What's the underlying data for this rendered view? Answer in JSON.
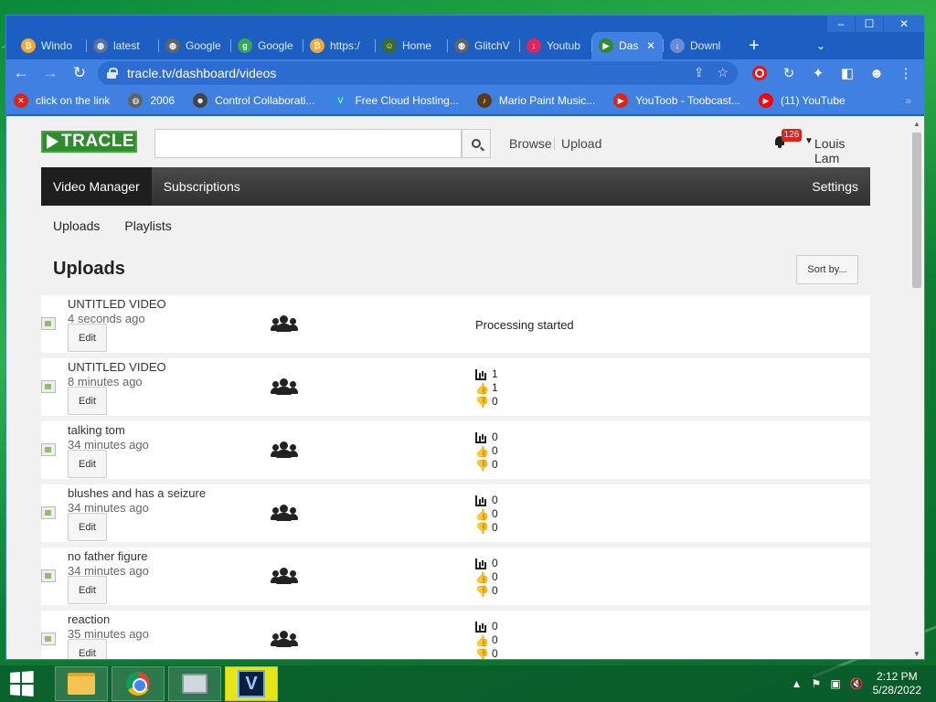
{
  "browser": {
    "tabs": [
      {
        "label": "Windo",
        "icon_color": "#f4a836",
        "icon_glyph": "₿",
        "active": false
      },
      {
        "label": "latest",
        "icon_color": "#5b6fa3",
        "icon_glyph": "◍",
        "active": false
      },
      {
        "label": "Google",
        "icon_color": "#5f6368",
        "icon_glyph": "◍",
        "active": false
      },
      {
        "label": "Google",
        "icon_color": "#34a853",
        "icon_glyph": "g",
        "active": false
      },
      {
        "label": "https:/",
        "icon_color": "#f4a836",
        "icon_glyph": "₿",
        "active": false
      },
      {
        "label": "Home",
        "icon_color": "#3d6b2a",
        "icon_glyph": "☺",
        "active": false
      },
      {
        "label": "GlitchV",
        "icon_color": "#5f6368",
        "icon_glyph": "◍",
        "active": false
      },
      {
        "label": "Youtub",
        "icon_color": "#e0245e",
        "icon_glyph": "↓",
        "active": false
      },
      {
        "label": "Das",
        "icon_color": "#2e8b2e",
        "icon_glyph": "▶",
        "active": true
      },
      {
        "label": "Downl",
        "icon_color": "#6b8bd6",
        "icon_glyph": "↓",
        "active": false
      }
    ],
    "new_tab_glyph": "+",
    "url": "tracle.tv/dashboard/videos",
    "bookmarks": [
      {
        "label": "click on the link",
        "icon_color": "#d9251c",
        "icon_glyph": "✕"
      },
      {
        "label": "2006",
        "icon_color": "#5f6368",
        "icon_glyph": "◍"
      },
      {
        "label": "Control Collaborati...",
        "icon_color": "#444444",
        "icon_glyph": "☻"
      },
      {
        "label": "Free Cloud Hosting...",
        "icon_color": "#2a8be0",
        "icon_glyph": "V"
      },
      {
        "label": "Mario Paint Music...",
        "icon_color": "#5a3a1a",
        "icon_glyph": "♪"
      },
      {
        "label": "YouToob - Toobcast...",
        "icon_color": "#d9251c",
        "icon_glyph": "▶"
      },
      {
        "label": "(11) YouTube",
        "icon_color": "#ff0000",
        "icon_glyph": "▶"
      }
    ]
  },
  "site": {
    "logo_text": "TRACLE",
    "search_placeholder": "",
    "nav_links": [
      "Browse",
      "Upload"
    ],
    "notification_count": "126",
    "user_name": "Louis Lam",
    "main_nav": [
      "Video Manager",
      "Subscriptions"
    ],
    "main_nav_right": "Settings",
    "sub_nav": [
      "Uploads",
      "Playlists"
    ],
    "section_title": "Uploads",
    "sort_label": "Sort by...",
    "edit_label": "Edit"
  },
  "videos": [
    {
      "title": "UNTITLED VIDEO",
      "time": "4 seconds ago",
      "status": "Processing started",
      "views": null,
      "likes": null,
      "dislikes": null
    },
    {
      "title": "UNTITLED VIDEO",
      "time": "8 minutes ago",
      "status": null,
      "views": "1",
      "likes": "1",
      "dislikes": "0"
    },
    {
      "title": "talking tom",
      "time": "34 minutes ago",
      "status": null,
      "views": "0",
      "likes": "0",
      "dislikes": "0"
    },
    {
      "title": "blushes and has a seizure",
      "time": "34 minutes ago",
      "status": null,
      "views": "0",
      "likes": "0",
      "dislikes": "0"
    },
    {
      "title": "no father figure",
      "time": "34 minutes ago",
      "status": null,
      "views": "0",
      "likes": "0",
      "dislikes": "0"
    },
    {
      "title": "reaction",
      "time": "35 minutes ago",
      "status": null,
      "views": "0",
      "likes": "0",
      "dislikes": "0"
    }
  ],
  "taskbar": {
    "time": "2:12 PM",
    "date": "5/28/2022",
    "app_letter": "V"
  },
  "colors": {
    "logo_green": "#2e8b2e",
    "browser_blue": "#3f80e0",
    "notif_red": "#d9251c"
  }
}
